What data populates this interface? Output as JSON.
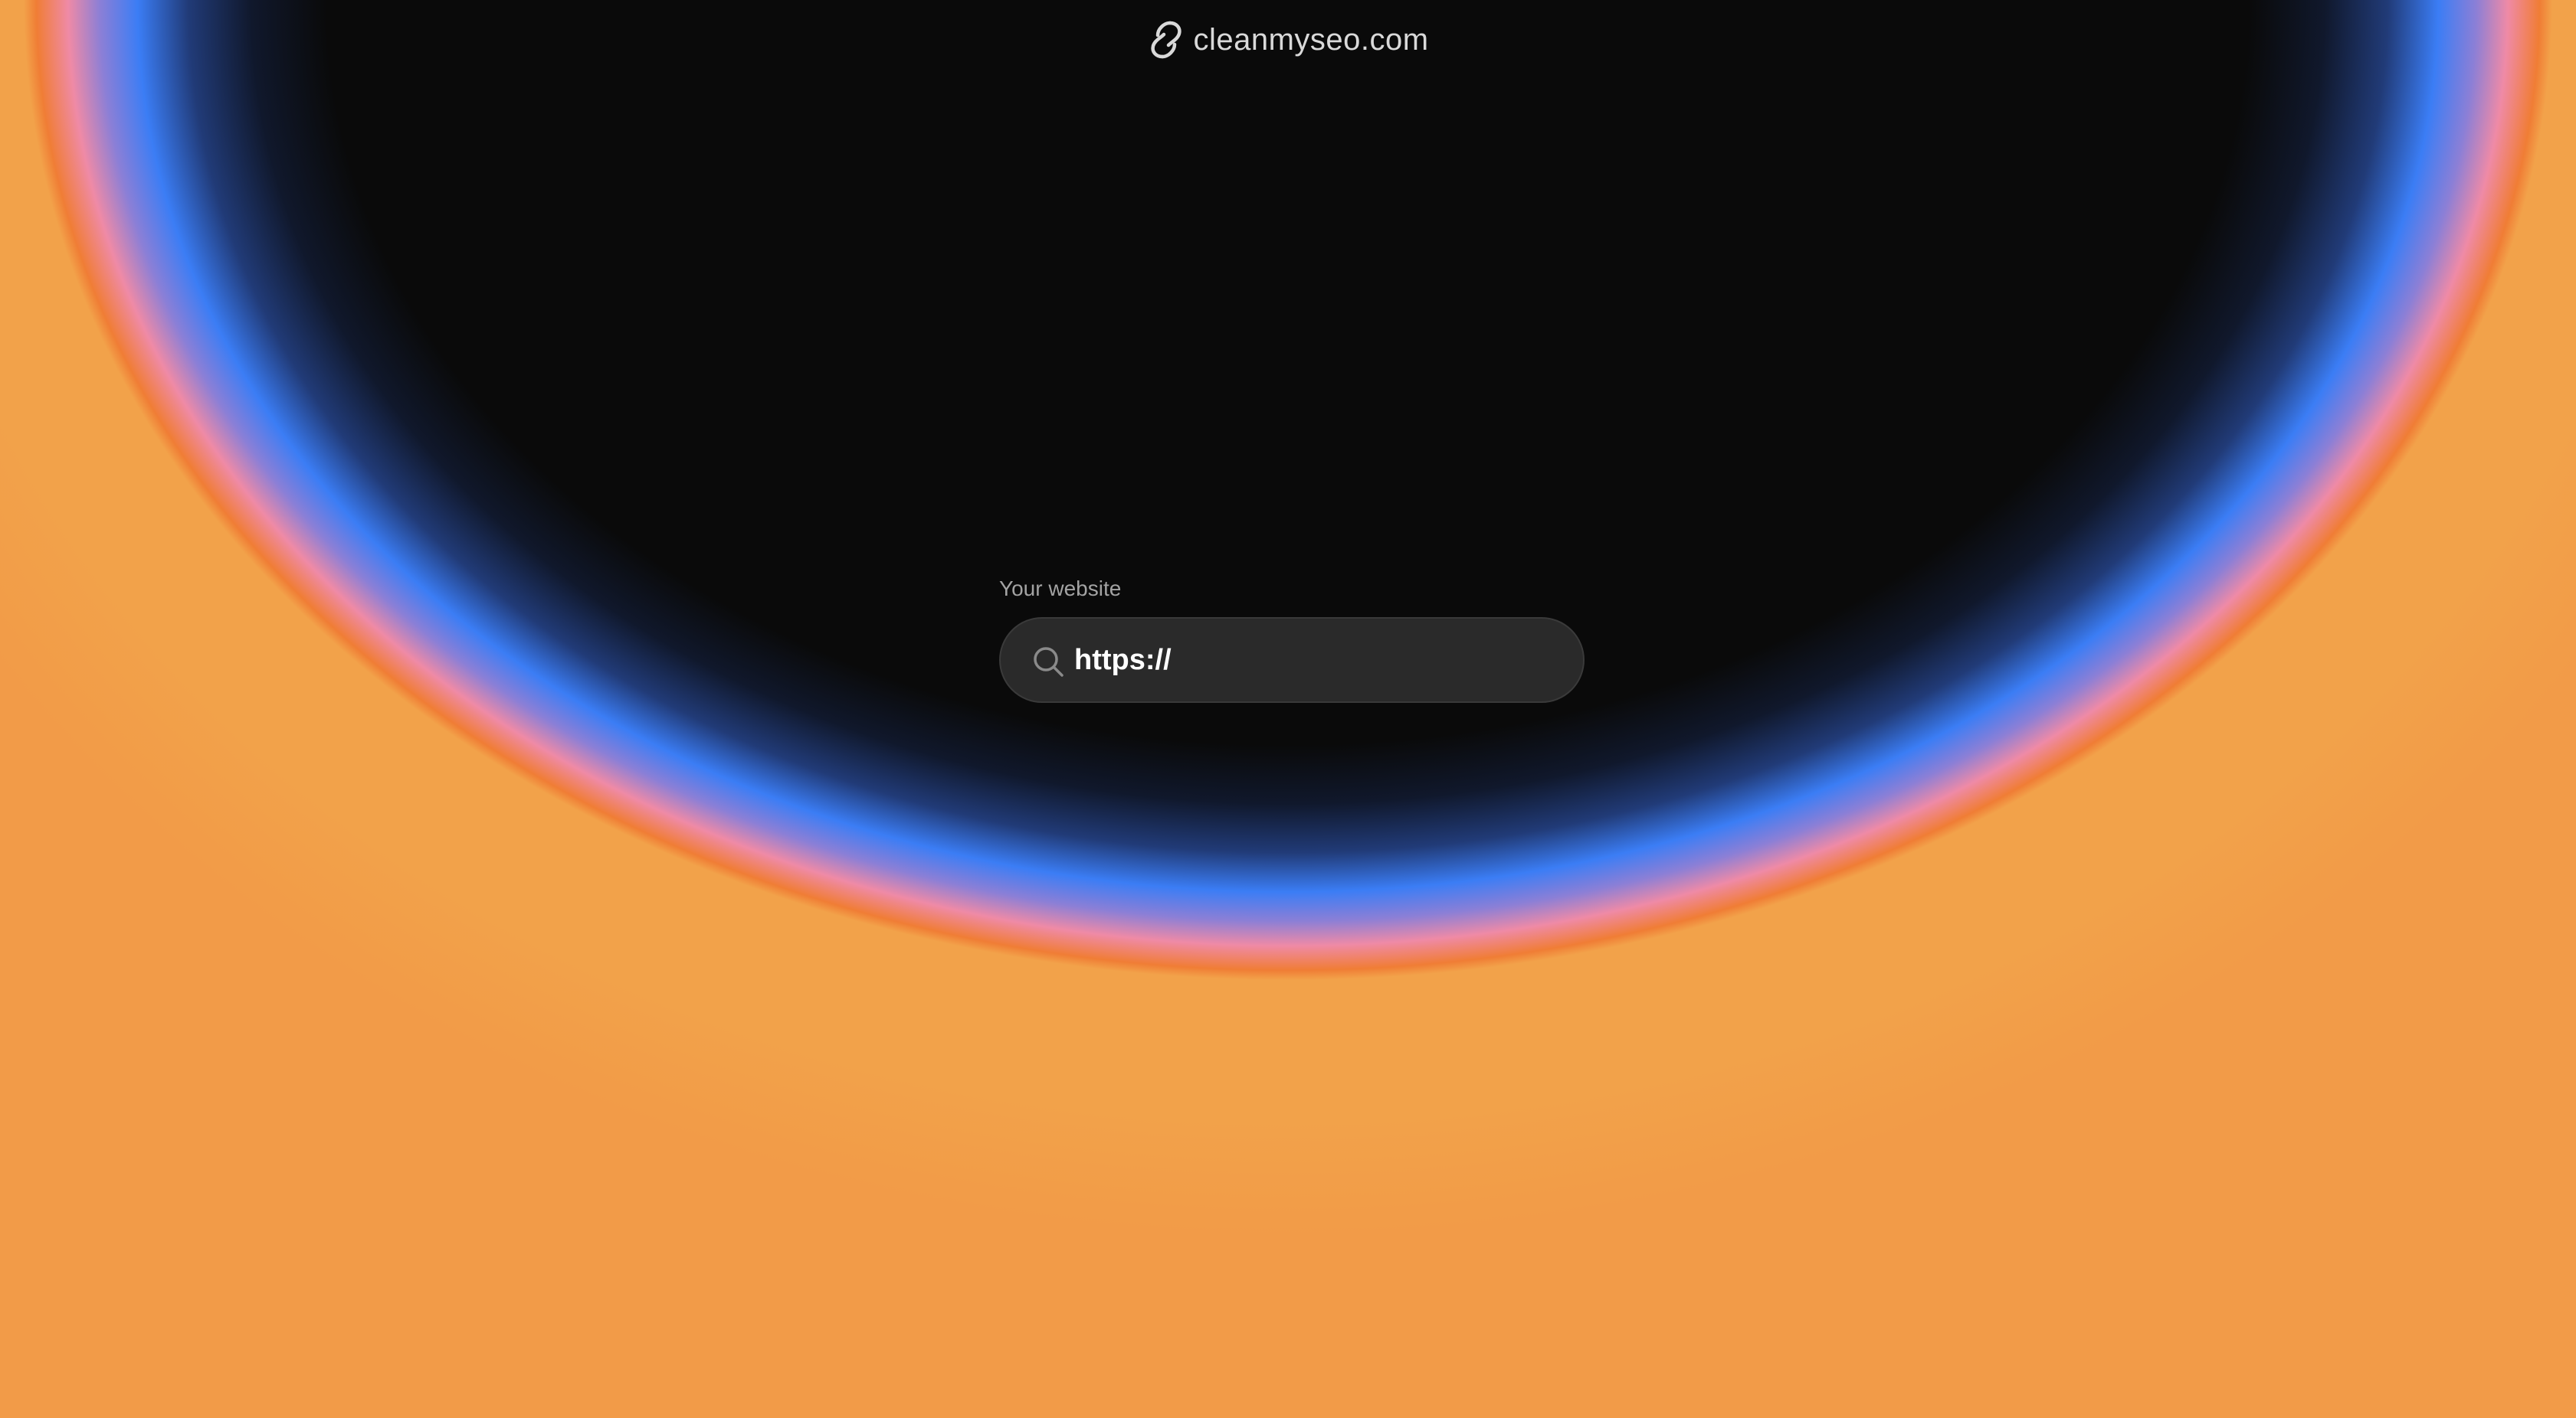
{
  "header": {
    "brand_name": "cleanmyseo.com",
    "brand_icon": "link-logo-icon"
  },
  "form": {
    "label": "Your website",
    "url_input": {
      "value": "https://",
      "icon": "search-icon"
    }
  },
  "colors": {
    "background": "#0a0a0a",
    "glow_blue": "#3b7df5",
    "glow_pink": "#ef8aa6",
    "glow_orange": "#f07d35",
    "input_background": "#2a2a2a",
    "label_text": "#a3a3a3",
    "brand_text": "#d9d9d9"
  }
}
